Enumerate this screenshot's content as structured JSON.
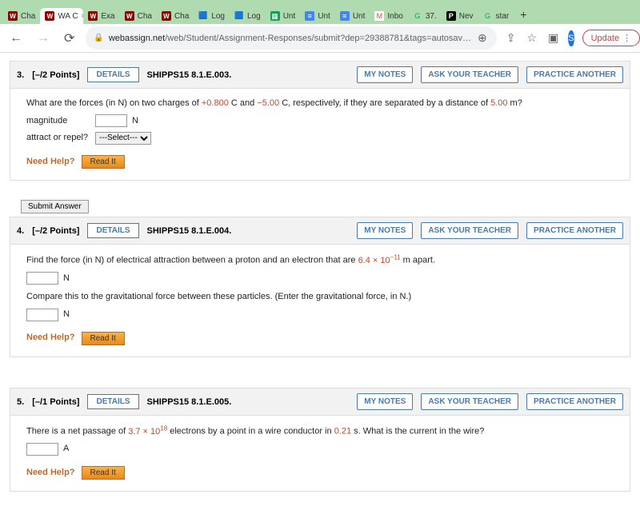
{
  "browser": {
    "tabs": [
      {
        "label": "Cha"
      },
      {
        "label": "WA C"
      },
      {
        "label": "Exa"
      },
      {
        "label": "Cha"
      },
      {
        "label": "Cha"
      },
      {
        "label": "Log"
      },
      {
        "label": "Log"
      },
      {
        "label": "Unt"
      },
      {
        "label": "Unt"
      },
      {
        "label": "Unt"
      },
      {
        "label": "Inbo"
      },
      {
        "label": "37."
      },
      {
        "label": "Nev"
      },
      {
        "label": "star"
      }
    ],
    "url_host": "webassign.net",
    "url_path": "/web/Student/Assignment-Responses/submit?dep=29388781&tags=autosav…",
    "avatar_letter": "S",
    "update_label": "Update"
  },
  "questions": [
    {
      "number": "3.",
      "points": "[–/2 Points]",
      "details": "DETAILS",
      "ref": "SHIPPS15 8.1.E.003.",
      "my_notes": "MY NOTES",
      "ask": "ASK YOUR TEACHER",
      "practice": "PRACTICE ANOTHER",
      "prompt_pre": "What are the forces (in N) on two charges of ",
      "q1_val1": "+0.800",
      "q1_mid1": " C and ",
      "q1_val2": "−5.00",
      "q1_mid2": " C, respectively, if they are separated by a distance of ",
      "q1_val3": "5.00",
      "q1_end": " m?",
      "mag_label": "magnitude",
      "mag_unit": "N",
      "ar_label": "attract or repel?",
      "ar_select": "---Select---",
      "need_help": "Need Help?",
      "read_it": "Read It",
      "submit": "Submit Answer"
    },
    {
      "number": "4.",
      "points": "[–/2 Points]",
      "details": "DETAILS",
      "ref": "SHIPPS15 8.1.E.004.",
      "my_notes": "MY NOTES",
      "ask": "ASK YOUR TEACHER",
      "practice": "PRACTICE ANOTHER",
      "line1_pre": "Find the force (in N) of electrical attraction between a proton and an electron that are ",
      "line1_val": "6.4 × 10",
      "line1_exp": "−11",
      "line1_end": " m apart.",
      "unit_n": "N",
      "line2": "Compare this to the gravitational force between these particles. (Enter the gravitational force, in N.)",
      "need_help": "Need Help?",
      "read_it": "Read It"
    },
    {
      "number": "5.",
      "points": "[–/1 Points]",
      "details": "DETAILS",
      "ref": "SHIPPS15 8.1.E.005.",
      "my_notes": "MY NOTES",
      "ask": "ASK YOUR TEACHER",
      "practice": "PRACTICE ANOTHER",
      "line_pre": "There is a net passage of ",
      "val1": "3.7 × 10",
      "exp1": "18",
      "mid": " electrons by a point in a wire conductor in ",
      "val2": "0.21",
      "end": " s. What is the current in the wire?",
      "unit_a": "A",
      "need_help": "Need Help?",
      "read_it": "Read It"
    }
  ]
}
